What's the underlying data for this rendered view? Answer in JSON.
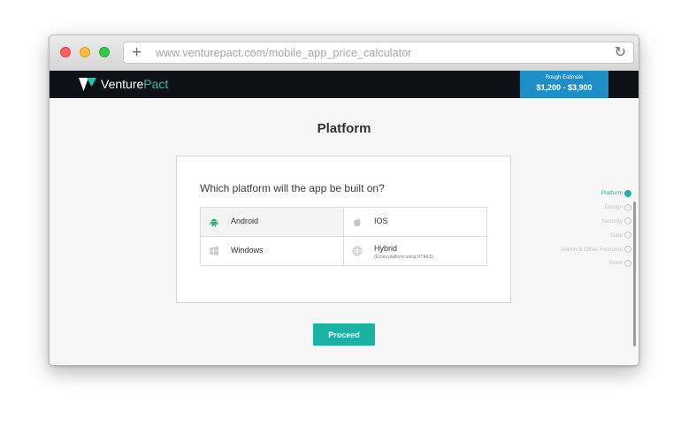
{
  "browser": {
    "url": "www.venturepact.com/mobile_app_price_calculator",
    "new_tab_glyph": "+",
    "reload_glyph": "↻"
  },
  "navbar": {
    "logo_part1": "Venture",
    "logo_part2": "Pact",
    "estimate_label": "Rough Estimate",
    "estimate_value": "$1,200 - $3,900"
  },
  "main": {
    "title": "Platform",
    "question": "Which platform will the app be built on?",
    "options": [
      {
        "label": "Android",
        "icon": "android-icon",
        "selected": true
      },
      {
        "label": "IOS",
        "icon": "apple-icon"
      },
      {
        "label": "Windows",
        "icon": "windows-icon"
      },
      {
        "label": "Hybrid",
        "sublabel": "(Cross platform using HTML5)",
        "icon": "globe-icon"
      }
    ],
    "proceed_label": "Proceed"
  },
  "steps": [
    {
      "label": "Platform",
      "active": true
    },
    {
      "label": "Design"
    },
    {
      "label": "Security"
    },
    {
      "label": "Data"
    },
    {
      "label": "Admin & Other Features"
    },
    {
      "label": "Done"
    }
  ],
  "colors": {
    "accent": "#1ab3a3",
    "navbar": "#0d1117",
    "estimate": "#1e8ec6"
  }
}
